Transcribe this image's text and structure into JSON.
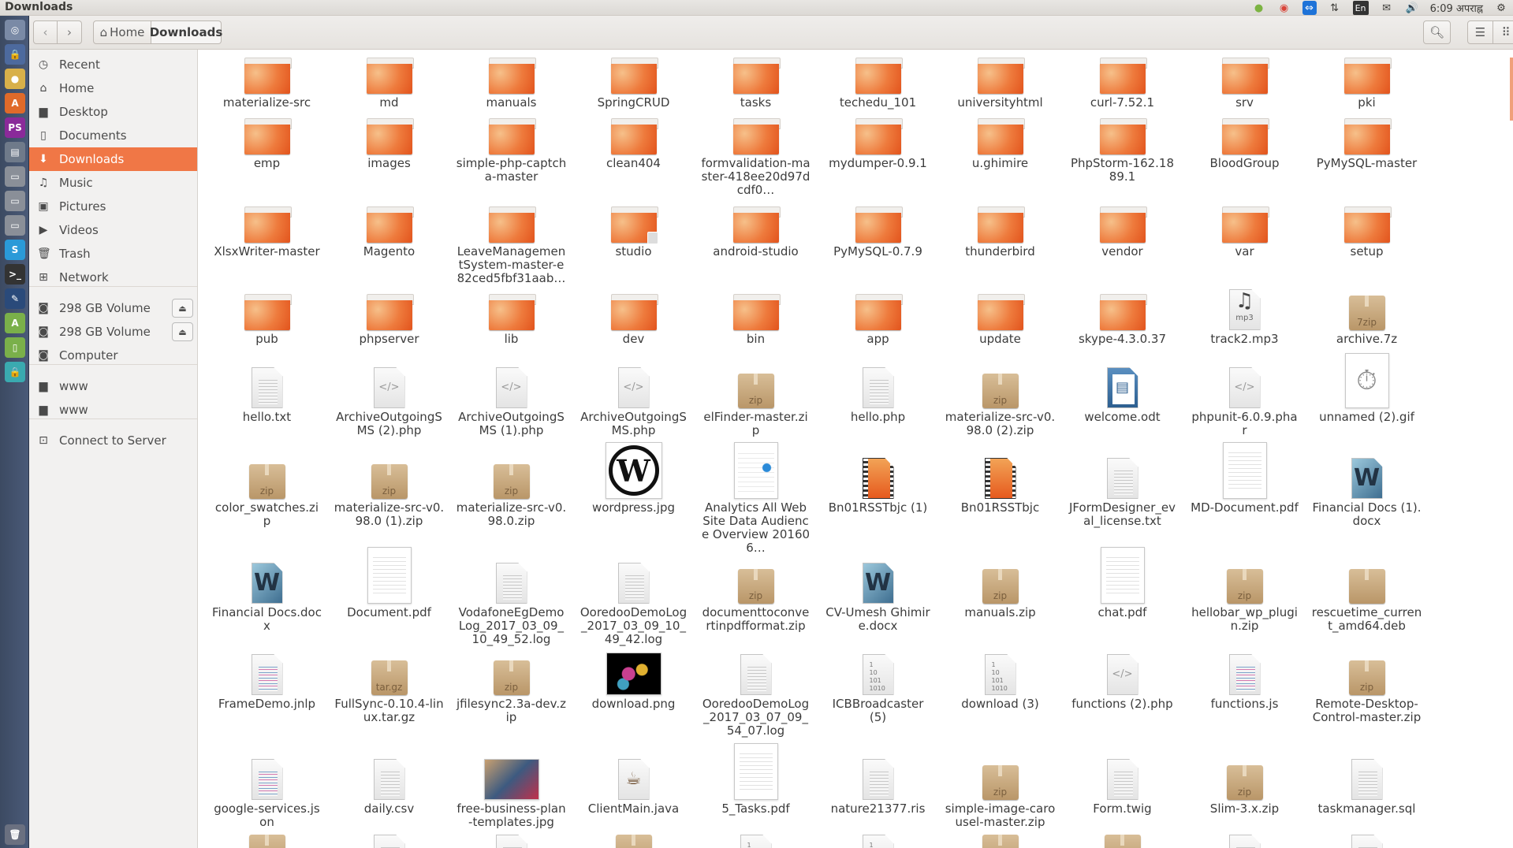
{
  "window": {
    "title": "Downloads"
  },
  "tray": {
    "language": "En",
    "clock": "6:09 अपराह्न",
    "icons": [
      "update-icon",
      "chrome-icon",
      "teamviewer-icon",
      "network-icon",
      "keyboard-icon",
      "mail-icon",
      "volume-icon",
      "power-icon"
    ]
  },
  "launcher": [
    {
      "name": "dash",
      "color": "#7a8aa6",
      "glyph": "◎"
    },
    {
      "name": "vpn",
      "color": "#4d6a9e",
      "glyph": "🔒"
    },
    {
      "name": "chrome",
      "color": "#d8b04a",
      "glyph": "●"
    },
    {
      "name": "software-center",
      "color": "#e06a2a",
      "glyph": "A"
    },
    {
      "name": "phpstorm",
      "color": "#8a2a9a",
      "glyph": "PS"
    },
    {
      "name": "files",
      "color": "#6f7a8a",
      "glyph": "▤"
    },
    {
      "name": "drive-1",
      "color": "#8a8f98",
      "glyph": "▭"
    },
    {
      "name": "drive-2",
      "color": "#8a8f98",
      "glyph": "▭"
    },
    {
      "name": "drive-3",
      "color": "#8a8f98",
      "glyph": "▭"
    },
    {
      "name": "skype",
      "color": "#2a9ad8",
      "glyph": "S"
    },
    {
      "name": "terminal",
      "color": "#333",
      "glyph": ">_"
    },
    {
      "name": "inkscape",
      "color": "#2a4a7a",
      "glyph": "✎"
    },
    {
      "name": "android-studio",
      "color": "#7ab04a",
      "glyph": "A"
    },
    {
      "name": "android-device",
      "color": "#7ab04a",
      "glyph": "▯"
    },
    {
      "name": "remote",
      "color": "#3aaab0",
      "glyph": "🔒"
    }
  ],
  "toolbar": {
    "back": "‹",
    "forward": "›",
    "breadcrumb": [
      {
        "label": "Home"
      },
      {
        "label": "Downloads"
      }
    ]
  },
  "sidebar": {
    "items": [
      {
        "label": "Recent",
        "icon": "clock-icon",
        "glyph": "◷"
      },
      {
        "label": "Home",
        "icon": "home-icon",
        "glyph": "⌂"
      },
      {
        "label": "Desktop",
        "icon": "desktop-folder-icon",
        "glyph": "▆"
      },
      {
        "label": "Documents",
        "icon": "documents-icon",
        "glyph": "▯"
      },
      {
        "label": "Downloads",
        "icon": "download-icon",
        "glyph": "⬇",
        "active": true
      },
      {
        "label": "Music",
        "icon": "music-icon",
        "glyph": "♫"
      },
      {
        "label": "Pictures",
        "icon": "pictures-icon",
        "glyph": "▣"
      },
      {
        "label": "Videos",
        "icon": "videos-icon",
        "glyph": "▶"
      },
      {
        "label": "Trash",
        "icon": "trash-icon",
        "glyph": "🗑"
      },
      {
        "label": "Network",
        "icon": "network-icon",
        "glyph": "⊞"
      },
      {
        "label": "298 GB Volume",
        "icon": "drive-icon",
        "glyph": "◙",
        "eject": true
      },
      {
        "label": "298 GB Volume",
        "icon": "drive-icon",
        "glyph": "◙",
        "eject": true
      },
      {
        "label": "Computer",
        "icon": "computer-icon",
        "glyph": "◙"
      },
      {
        "label": "www",
        "icon": "folder-icon",
        "glyph": "▆"
      },
      {
        "label": "www",
        "icon": "folder-icon",
        "glyph": "▆"
      },
      {
        "label": "Connect to Server",
        "icon": "server-icon",
        "glyph": "⊡"
      }
    ],
    "eject_glyph": "⏏"
  },
  "files": [
    [
      {
        "n": "materialize-src",
        "t": "folder"
      },
      {
        "n": "md",
        "t": "folder"
      },
      {
        "n": "manuals",
        "t": "folder"
      },
      {
        "n": "SpringCRUD",
        "t": "folder"
      },
      {
        "n": "tasks",
        "t": "folder"
      },
      {
        "n": "techedu_101",
        "t": "folder"
      },
      {
        "n": "universityhtml",
        "t": "folder"
      },
      {
        "n": "curl-7.52.1",
        "t": "folder"
      },
      {
        "n": "srv",
        "t": "folder"
      },
      {
        "n": "pki",
        "t": "folder"
      }
    ],
    [
      {
        "n": "emp",
        "t": "folder"
      },
      {
        "n": "images",
        "t": "folder"
      },
      {
        "n": "simple-php-captcha-master",
        "t": "folder"
      },
      {
        "n": "clean404",
        "t": "folder"
      },
      {
        "n": "formvalidation-master-418ee20d97dcdf0…",
        "t": "folder"
      },
      {
        "n": "mydumper-0.9.1",
        "t": "folder"
      },
      {
        "n": "u.ghimire",
        "t": "folder"
      },
      {
        "n": "PhpStorm-162.1889.1",
        "t": "folder"
      },
      {
        "n": "BloodGroup",
        "t": "folder"
      },
      {
        "n": "PyMySQL-master",
        "t": "folder"
      }
    ],
    [
      {
        "n": "XlsxWriter-master",
        "t": "folder"
      },
      {
        "n": "Magento",
        "t": "folder"
      },
      {
        "n": "LeaveManagementSystem-master-e82ced5fbf31aab…",
        "t": "folder"
      },
      {
        "n": "studio",
        "t": "folder-locked"
      },
      {
        "n": "android-studio",
        "t": "folder"
      },
      {
        "n": "PyMySQL-0.7.9",
        "t": "folder"
      },
      {
        "n": "thunderbird",
        "t": "folder"
      },
      {
        "n": "vendor",
        "t": "folder"
      },
      {
        "n": "var",
        "t": "folder"
      },
      {
        "n": "setup",
        "t": "folder"
      }
    ],
    [
      {
        "n": "pub",
        "t": "folder"
      },
      {
        "n": "phpserver",
        "t": "folder"
      },
      {
        "n": "lib",
        "t": "folder"
      },
      {
        "n": "dev",
        "t": "folder"
      },
      {
        "n": "bin",
        "t": "folder"
      },
      {
        "n": "app",
        "t": "folder"
      },
      {
        "n": "update",
        "t": "folder"
      },
      {
        "n": "skype-4.3.0.37",
        "t": "folder"
      },
      {
        "n": "track2.mp3",
        "t": "audio",
        "b": "mp3"
      },
      {
        "n": "archive.7z",
        "t": "box",
        "b": "7zip"
      }
    ],
    [
      {
        "n": "hello.txt",
        "t": "text"
      },
      {
        "n": "ArchiveOutgoingSMS (2).php",
        "t": "code",
        "b": "</>"
      },
      {
        "n": "ArchiveOutgoingSMS (1).php",
        "t": "code",
        "b": "</>"
      },
      {
        "n": "ArchiveOutgoingSMS.php",
        "t": "code",
        "b": "</>"
      },
      {
        "n": "elFinder-master.zip",
        "t": "box",
        "b": "zip"
      },
      {
        "n": "hello.php",
        "t": "text"
      },
      {
        "n": "materialize-src-v0.98.0 (2).zip",
        "t": "box",
        "b": "zip"
      },
      {
        "n": "welcome.odt",
        "t": "odt"
      },
      {
        "n": "phpunit-6.0.9.phar",
        "t": "code",
        "b": "</>"
      },
      {
        "n": "unnamed (2).gif",
        "t": "gif"
      }
    ],
    [
      {
        "n": "color_swatches.zip",
        "t": "box",
        "b": "zip"
      },
      {
        "n": "materialize-src-v0.98.0 (1).zip",
        "t": "box",
        "b": "zip"
      },
      {
        "n": "materialize-src-v0.98.0.zip",
        "t": "box",
        "b": "zip"
      },
      {
        "n": "wordpress.jpg",
        "t": "wp",
        "b": "W"
      },
      {
        "n": "Analytics All Web Site Data Audience Overview 201606…",
        "t": "sheet"
      },
      {
        "n": "Bn01RSSTbjc (1)",
        "t": "video"
      },
      {
        "n": "Bn01RSSTbjc",
        "t": "video"
      },
      {
        "n": "JFormDesigner_eval_license.txt",
        "t": "text"
      },
      {
        "n": "MD-Document.pdf",
        "t": "pdf"
      },
      {
        "n": "Financial Docs (1).docx",
        "t": "docx",
        "b": "W"
      }
    ],
    [
      {
        "n": "Financial Docs.docx",
        "t": "docx",
        "b": "W"
      },
      {
        "n": "Document.pdf",
        "t": "pdf"
      },
      {
        "n": "VodafoneEgDemoLog_2017_03_09_10_49_52.log",
        "t": "text"
      },
      {
        "n": "OoredooDemoLog_2017_03_09_10_49_42.log",
        "t": "text"
      },
      {
        "n": "documenttoconvertinpdfformat.zip",
        "t": "box",
        "b": "zip"
      },
      {
        "n": "CV-Umesh Ghimire.docx",
        "t": "docx",
        "b": "W"
      },
      {
        "n": "manuals.zip",
        "t": "box",
        "b": "zip"
      },
      {
        "n": "chat.pdf",
        "t": "pdf"
      },
      {
        "n": "hellobar_wp_plugin.zip",
        "t": "box",
        "b": "zip"
      },
      {
        "n": "rescuetime_current_amd64.deb",
        "t": "box",
        "b": ""
      }
    ],
    [
      {
        "n": "FrameDemo.jnlp",
        "t": "color"
      },
      {
        "n": "FullSync-0.10.4-linux.tar.gz",
        "t": "box",
        "b": "tar.gz"
      },
      {
        "n": "jfilesync2.3a-dev.zip",
        "t": "box",
        "b": "zip"
      },
      {
        "n": "download.png",
        "t": "dark"
      },
      {
        "n": "OoredooDemoLog_2017_03_07_09_54_07.log",
        "t": "text"
      },
      {
        "n": "ICBBroadcaster (5)",
        "t": "bin",
        "b": "1\n10\n101\n1010"
      },
      {
        "n": "download (3)",
        "t": "bin",
        "b": "1\n10\n101\n1010"
      },
      {
        "n": "functions (2).php",
        "t": "code",
        "b": "</>"
      },
      {
        "n": "functions.js",
        "t": "color"
      },
      {
        "n": "Remote-Desktop-Control-master.zip",
        "t": "box",
        "b": "zip"
      }
    ],
    [
      {
        "n": "google-services.json",
        "t": "color"
      },
      {
        "n": "daily.csv",
        "t": "text"
      },
      {
        "n": "free-business-plan-templates.jpg",
        "t": "photo"
      },
      {
        "n": "ClientMain.java",
        "t": "java",
        "b": "☕"
      },
      {
        "n": "5_Tasks.pdf",
        "t": "pdf"
      },
      {
        "n": "nature21377.ris",
        "t": "text"
      },
      {
        "n": "simple-image-carousel-master.zip",
        "t": "box",
        "b": "zip"
      },
      {
        "n": "Form.twig",
        "t": "text"
      },
      {
        "n": "Slim-3.x.zip",
        "t": "box",
        "b": "zip"
      },
      {
        "n": "taskmanager.sql",
        "t": "text"
      }
    ]
  ],
  "partial_row_types": [
    "box",
    "text",
    "text",
    "box",
    "bin",
    "bin",
    "box",
    "box",
    "text",
    "text"
  ]
}
